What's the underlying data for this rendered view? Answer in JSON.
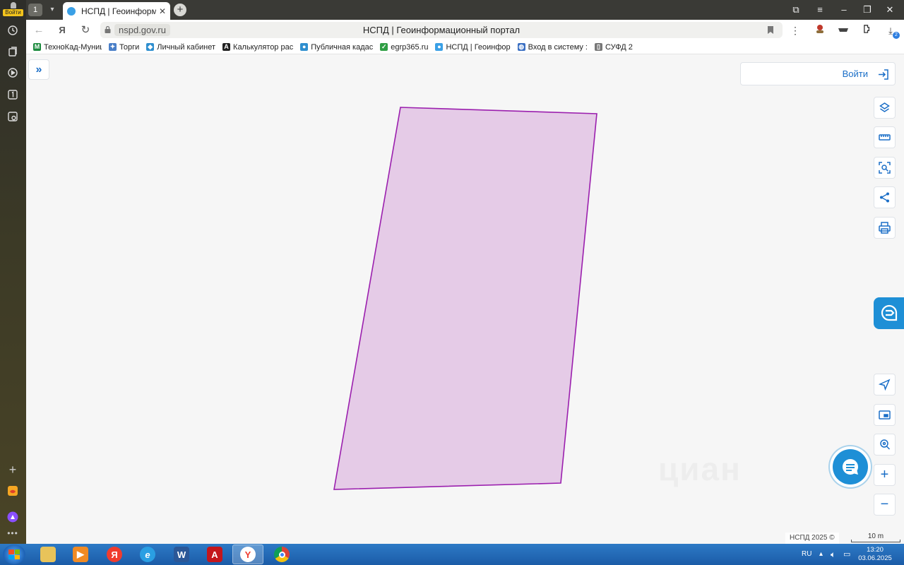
{
  "browser": {
    "sidebar": {
      "login_label": "Войти"
    },
    "tabs": {
      "count": "1",
      "active_title": "НСПД | Геоинформационный портал"
    },
    "address": {
      "host": "nspd.gov.ru",
      "page_title": "НСПД | Геоинформационный портал",
      "downloads_count": "2"
    },
    "bookmarks": [
      {
        "label": "ТехноКад-Муниц",
        "icon": "m-logo",
        "color": "#1b8a3d"
      },
      {
        "label": "Торги",
        "icon": "emblem",
        "color": "#4a7fc8"
      },
      {
        "label": "Личный кабинет",
        "icon": "rosreestr",
        "color": "#2f8fcf"
      },
      {
        "label": "Калькулятор рас",
        "icon": "a-logo",
        "color": "#222222"
      },
      {
        "label": "Публичная кадас",
        "icon": "map-pin",
        "color": "#2f8fcf"
      },
      {
        "label": "egrp365.ru",
        "icon": "check-circle",
        "color": "#2f9e44"
      },
      {
        "label": "НСПД | Геоинфор",
        "icon": "nspd-logo",
        "color": "#3aa0e6"
      },
      {
        "label": "Вход в систему :",
        "icon": "globe",
        "color": "#3a6fc2"
      },
      {
        "label": "СУФД 2",
        "icon": "document",
        "color": "#777777"
      }
    ]
  },
  "map": {
    "login_label": "Войти",
    "copyright": "НСПД 2025 ©",
    "scale_label": "10 m",
    "watermark": "циан",
    "parcel": {
      "fill": "#e5cbe7",
      "stroke": "#9b1fae"
    },
    "tools_top": [
      "layers-icon",
      "ruler-icon",
      "area-select-icon",
      "share-icon",
      "print-icon"
    ],
    "tools_bottom": [
      "locate-icon",
      "minimap-icon",
      "search-location-icon",
      "zoom-in-icon",
      "zoom-out-icon"
    ]
  },
  "taskbar": {
    "apps": [
      "file-explorer",
      "media-player",
      "yandex",
      "internet-explorer",
      "word",
      "acrobat",
      "yandex-browser",
      "chrome"
    ],
    "lang": "RU",
    "time": "13:20",
    "date": "03.06.2025"
  }
}
